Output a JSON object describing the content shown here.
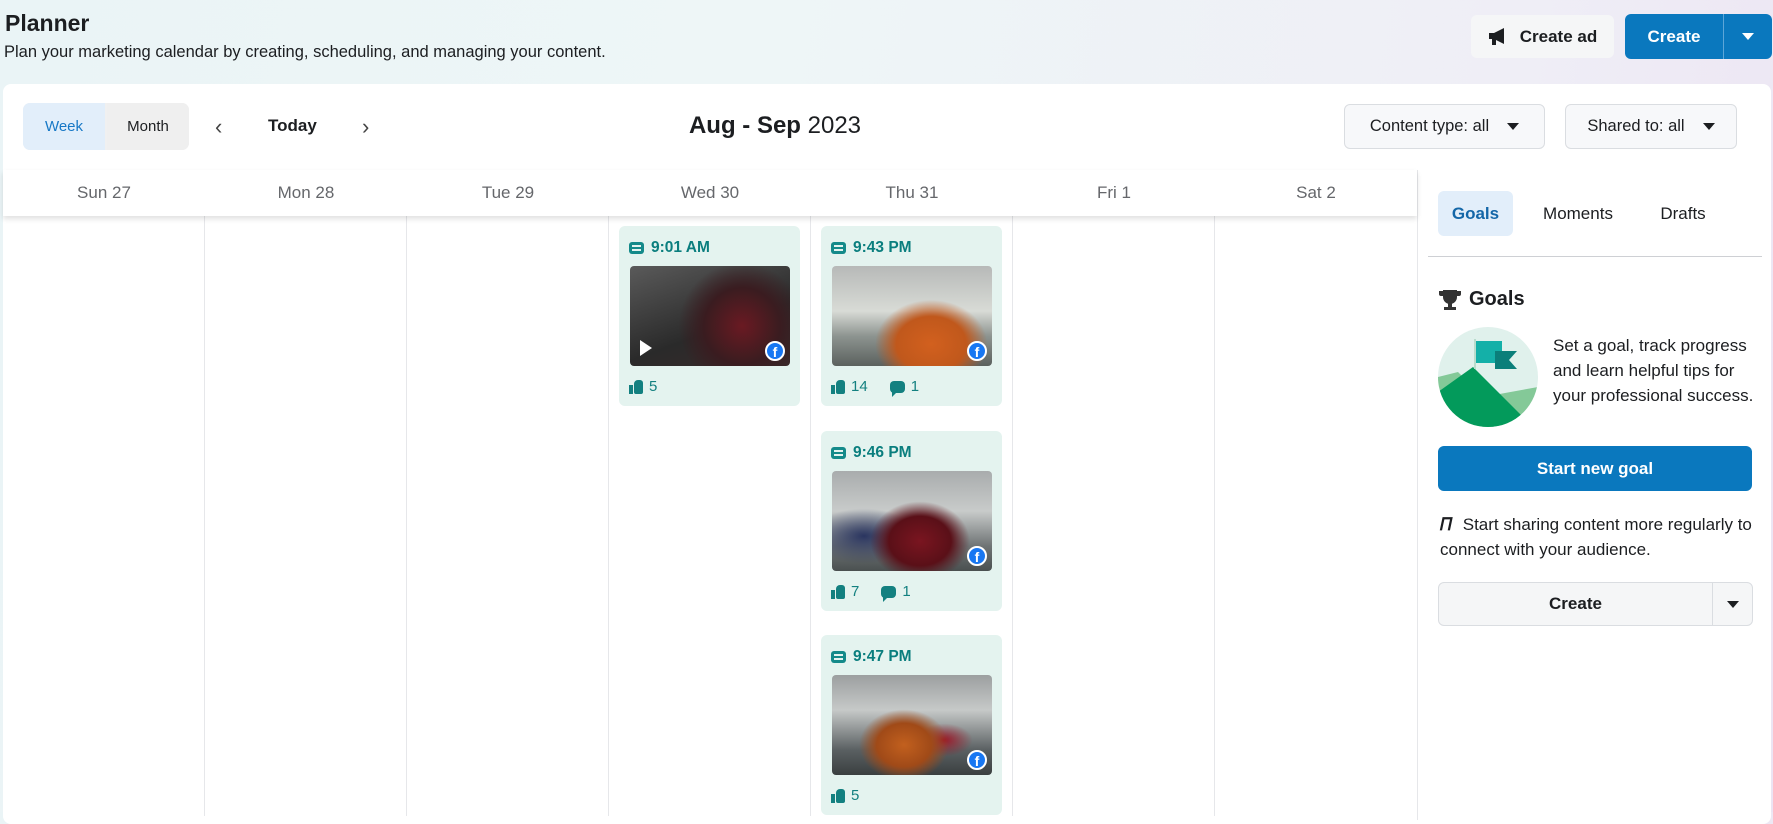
{
  "header": {
    "title": "Planner",
    "subtitle": "Plan your marketing calendar by creating, scheduling, and managing your content.",
    "create_ad": "Create ad",
    "create": "Create"
  },
  "toolbar": {
    "week": "Week",
    "month": "Month",
    "today": "Today",
    "range_bold": "Aug - Sep",
    "range_year": "2023",
    "content_type": "Content type: all",
    "shared_to": "Shared to: all"
  },
  "days": [
    "Sun 27",
    "Mon 28",
    "Tue 29",
    "Wed 30",
    "Thu 31",
    "Fri 1",
    "Sat 2"
  ],
  "posts": [
    {
      "day": "Wed 30",
      "time": "9:01 AM",
      "type": "video",
      "likes": "5",
      "comments": null
    },
    {
      "day": "Thu 31",
      "time": "9:43 PM",
      "type": "photo",
      "likes": "14",
      "comments": "1"
    },
    {
      "day": "Thu 31",
      "time": "9:46 PM",
      "type": "photo",
      "likes": "7",
      "comments": "1"
    },
    {
      "day": "Thu 31",
      "time": "9:47 PM",
      "type": "photo",
      "likes": "5",
      "comments": null
    }
  ],
  "sidebar": {
    "tabs": [
      "Goals",
      "Moments",
      "Drafts"
    ],
    "goals_heading": "Goals",
    "goal_text": "Set a goal, track progress and learn helpful tips for your professional success.",
    "start_goal": "Start new goal",
    "share_text": "Start sharing content more regularly to connect with your audience.",
    "create": "Create"
  },
  "colors": {
    "accent": "#0a78be",
    "post_bg": "#e4f3ef",
    "post_text": "#0a7e7e"
  }
}
